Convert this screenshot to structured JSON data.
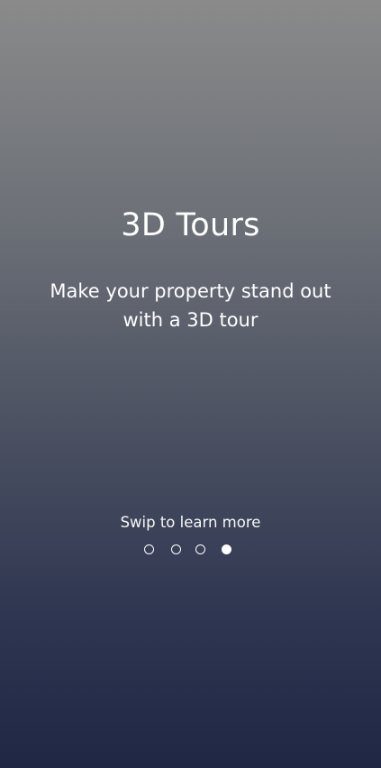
{
  "onboarding": {
    "title": "3D Tours",
    "subtitle": "Make your property stand out with a 3D tour",
    "hint": "Swip to learn more",
    "pagination": {
      "total_pages": 4,
      "active_page": 4
    }
  }
}
